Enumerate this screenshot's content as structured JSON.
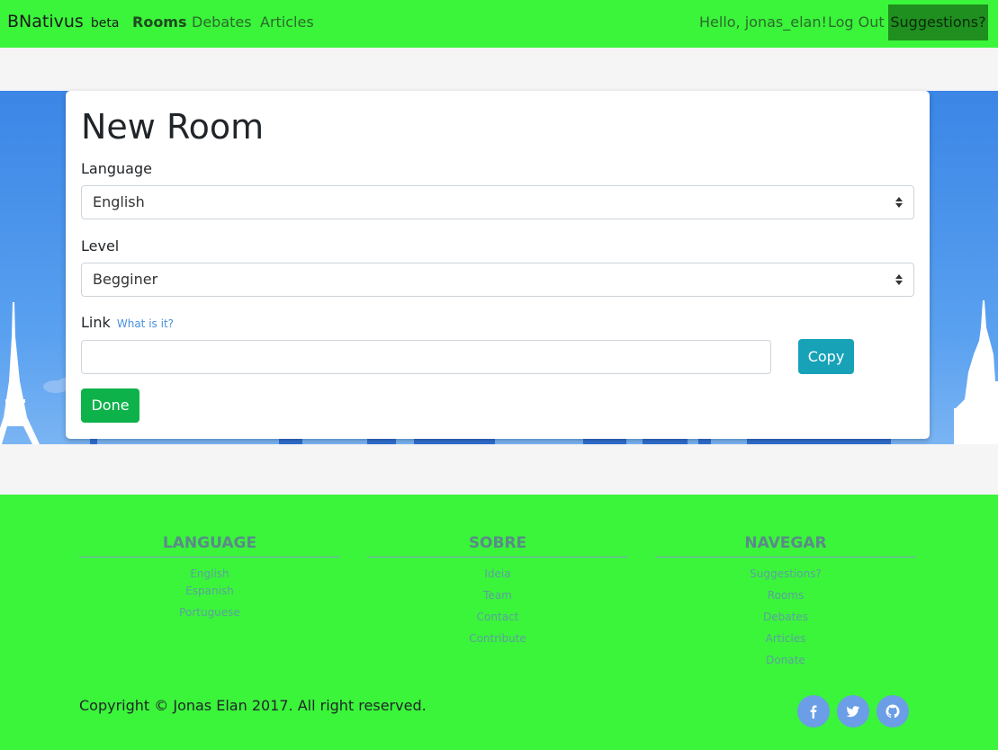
{
  "nav": {
    "brand": "BNativus",
    "brand_tag": "beta",
    "links": [
      "Rooms",
      "Debates",
      "Articles"
    ],
    "greeting": "Hello, jonas_elan!",
    "logout": "Log Out",
    "suggestions": "Suggestions?"
  },
  "form": {
    "title": "New Room",
    "language_label": "Language",
    "language_value": "English",
    "level_label": "Level",
    "level_value": "Begginer",
    "link_label": "Link",
    "link_help": "What is it?",
    "link_value": "",
    "copy_label": "Copy",
    "done_label": "Done"
  },
  "footer": {
    "columns": [
      {
        "title": "LANGUAGE",
        "items": [
          "English",
          "Espanish",
          "Portuguese"
        ]
      },
      {
        "title": "SOBRE",
        "items": [
          "Ideia",
          "Team",
          "Contact",
          "Contribute"
        ]
      },
      {
        "title": "NAVEGAR",
        "items": [
          "Suggestions?",
          "Rooms",
          "Debates",
          "Articles",
          "Donate"
        ]
      }
    ],
    "copyright": "Copyright © Jonas Elan 2017. All right reserved.",
    "social": [
      "facebook-icon",
      "twitter-icon",
      "github-icon"
    ]
  },
  "colors": {
    "nav_bg": "#3af53a",
    "accent_copy": "#17a2b8",
    "accent_done": "#0db24a",
    "hero_sky": "#3b86e6"
  }
}
